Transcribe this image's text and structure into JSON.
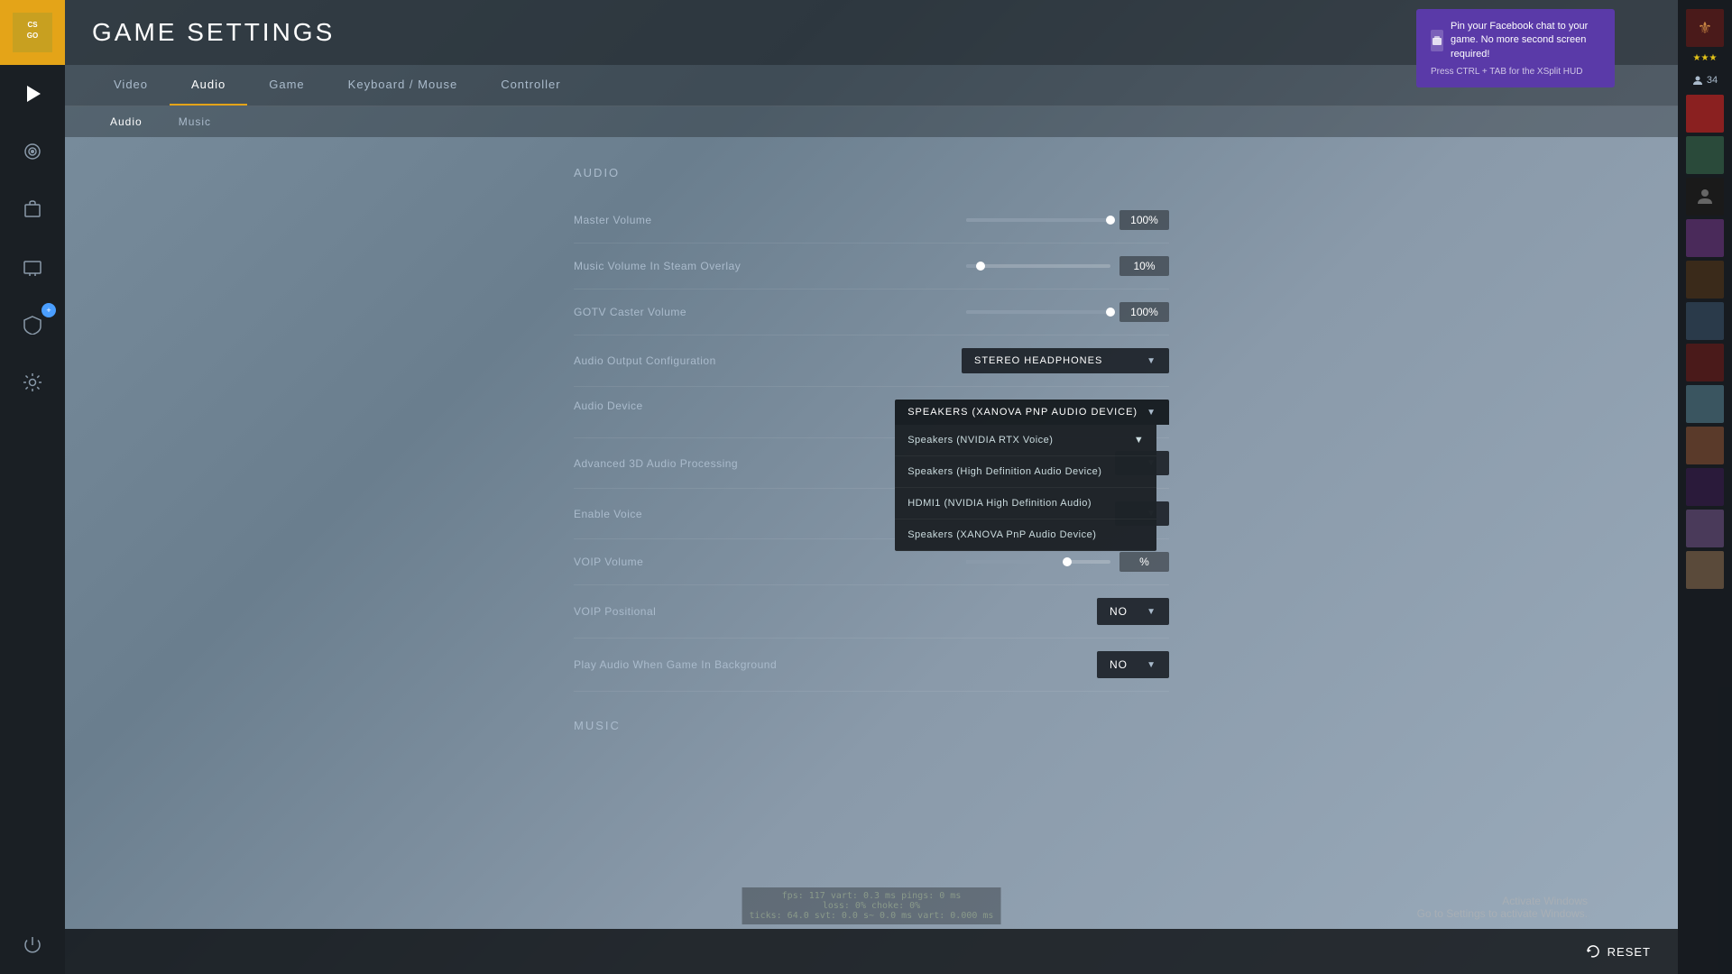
{
  "app": {
    "title": "GAME SETTINGS",
    "logo_text": "CS:GO"
  },
  "sidebar": {
    "icons": [
      {
        "name": "play-icon",
        "symbol": "▶",
        "active": true
      },
      {
        "name": "radio-icon",
        "symbol": "📡",
        "active": false
      },
      {
        "name": "inventory-icon",
        "symbol": "🎒",
        "active": false
      },
      {
        "name": "tv-icon",
        "symbol": "📺",
        "active": false
      },
      {
        "name": "shield-icon",
        "symbol": "🛡",
        "badge": "+",
        "active": false
      },
      {
        "name": "settings-icon",
        "symbol": "⚙",
        "active": false
      },
      {
        "name": "power-icon",
        "symbol": "⏻",
        "active": false
      }
    ]
  },
  "nav": {
    "items": [
      {
        "label": "Video",
        "active": false
      },
      {
        "label": "Audio",
        "active": true
      },
      {
        "label": "Game",
        "active": false
      },
      {
        "label": "Keyboard / Mouse",
        "active": false
      },
      {
        "label": "Controller",
        "active": false
      }
    ]
  },
  "sub_nav": {
    "items": [
      {
        "label": "Audio",
        "active": true
      },
      {
        "label": "Music",
        "active": false
      }
    ]
  },
  "audio_section": {
    "title": "Audio",
    "settings": [
      {
        "label": "Master Volume",
        "type": "slider",
        "value": "100%",
        "fill_pct": 100
      },
      {
        "label": "Music Volume In Steam Overlay",
        "type": "slider",
        "value": "10%",
        "fill_pct": 10
      },
      {
        "label": "GOTV Caster Volume",
        "type": "slider",
        "value": "100%",
        "fill_pct": 100
      },
      {
        "label": "Audio Output Configuration",
        "type": "dropdown",
        "value": "STEREO HEADPHONES"
      },
      {
        "label": "Audio Device",
        "type": "dropdown_open",
        "value": "SPEAKERS (XANOVA PNP AUDIO DEVICE)"
      },
      {
        "label": "Advanced 3D Audio Processing",
        "type": "dropdown",
        "value": ""
      },
      {
        "label": "Enable Voice",
        "type": "dropdown",
        "value": ""
      },
      {
        "label": "VOIP Volume",
        "type": "slider_value",
        "value": "%"
      },
      {
        "label": "VOIP Positional",
        "type": "no_dropdown",
        "value": "NO"
      },
      {
        "label": "Play Audio When Game In Background",
        "type": "no_dropdown",
        "value": "NO"
      }
    ],
    "dropdown_options": [
      {
        "label": "Speakers (NVIDIA RTX Voice)",
        "has_arrow": true
      },
      {
        "label": "Speakers (High Definition Audio Device)",
        "has_arrow": false
      },
      {
        "label": "HDMI1 (NVIDIA High Definition Audio)",
        "has_arrow": false
      },
      {
        "label": "Speakers (XANOVA PnP Audio Device)",
        "has_arrow": false
      }
    ]
  },
  "music_section": {
    "title": "Music"
  },
  "bottom": {
    "reset_label": "RESET",
    "debug_line1": "fps:  117  vart: 0.3 ms  pings: 0 ms",
    "debug_line2": "loss:  0%  choke: 0%",
    "debug_line3": "ticks: 64.0  svt: 0.0 s~ 0.0 ms  vart: 0.000 ms"
  },
  "windows_watermark": {
    "line1": "Activate Windows",
    "line2": "Go to Settings to activate Windows."
  },
  "notification": {
    "title": "Pin your Facebook chat to your game. No more second screen required!",
    "hint": "Press CTRL + TAB for the XSplit HUD"
  },
  "right_panel": {
    "friend_count": "34",
    "stars": "★★★"
  }
}
